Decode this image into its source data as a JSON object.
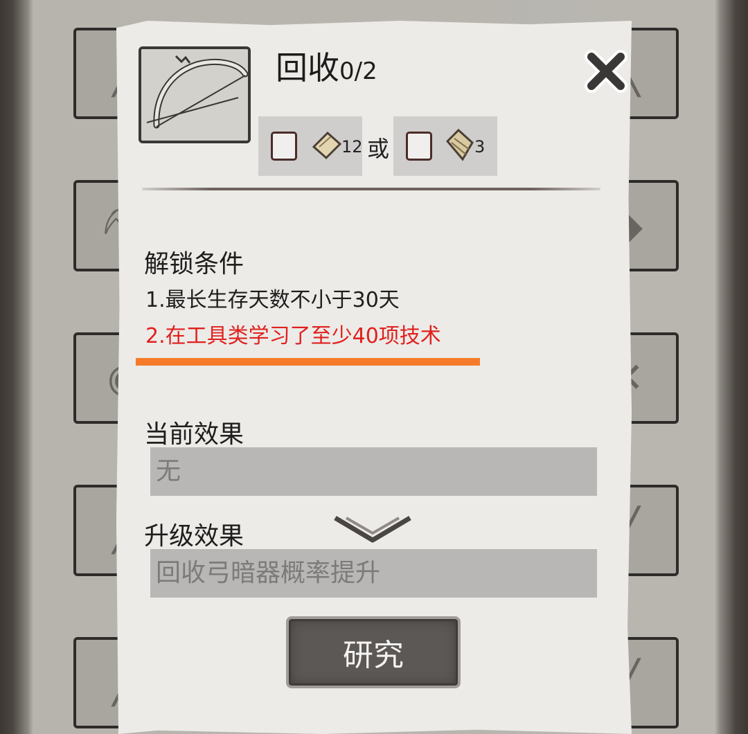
{
  "dialog": {
    "title": "回收",
    "progress": "0/2",
    "item_icon": "bow-icon",
    "close_icon": "close-icon"
  },
  "cost": {
    "options": [
      {
        "icon": "paper-scroll-icon",
        "count": "12"
      },
      {
        "icon": "book-icon",
        "count": "3"
      }
    ],
    "or_label": "或"
  },
  "unlock": {
    "title": "解锁条件",
    "conditions": [
      {
        "text": "1.最长生存天数不小于30天",
        "met": true,
        "color": "#1f1e1d"
      },
      {
        "text": "2.在工具类学习了至少40项技术",
        "met": false,
        "color": "#e0201d"
      }
    ],
    "highlight_color": "#f57b2b"
  },
  "current_effect": {
    "title": "当前效果",
    "value": "无"
  },
  "upgrade_effect": {
    "title": "升级效果",
    "value": "回收弓暗器概率提升"
  },
  "research_button": {
    "label": "研究"
  }
}
